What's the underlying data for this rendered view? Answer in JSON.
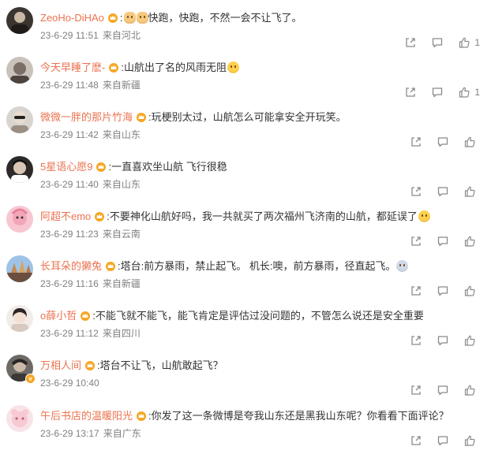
{
  "theme": {
    "username_color": "#eb7350",
    "meta_color": "#808080",
    "text_color": "#333333",
    "badge_color": "#f5a623"
  },
  "icons": {
    "share": "share-icon",
    "comment": "comment-icon",
    "like": "thumbs-up-icon",
    "member": "crown-icon"
  },
  "comments": [
    {
      "user": "ZeoHo-DiHAo",
      "text": ":",
      "text2": "快跑，快跑，不然一会不让飞了。",
      "emoji": "cat",
      "emoji_count": 2,
      "time": "23-6-29 11:51",
      "location": "来自河北",
      "likes": "1",
      "avatar": "a0"
    },
    {
      "user": "今天早睡了麽-",
      "text": ":山航出了名的风雨无阻",
      "text2": "",
      "emoji": "tear",
      "emoji_count": 1,
      "time": "23-6-29 11:48",
      "location": "来自新疆",
      "likes": "1",
      "avatar": "a1"
    },
    {
      "user": "微微一胖的那片竹海",
      "text": ":玩梗别太过，山航怎么可能拿安全开玩笑。",
      "text2": "",
      "emoji": "",
      "emoji_count": 0,
      "time": "23-6-29 11:42",
      "location": "来自山东",
      "likes": "",
      "avatar": "a2"
    },
    {
      "user": "5星语心愿9",
      "text": ":一直喜欢坐山航  飞行很稳",
      "text2": "",
      "emoji": "",
      "emoji_count": 0,
      "time": "23-6-29 11:40",
      "location": "来自山东",
      "likes": "",
      "avatar": "a3"
    },
    {
      "user": "阿超不emo",
      "text": ":不要神化山航好吗，我一共就买了两次福州飞济南的山航，都延误了",
      "text2": "",
      "emoji": "scream",
      "emoji_count": 1,
      "time": "23-6-29 11:23",
      "location": "来自云南",
      "likes": "",
      "avatar": "a4"
    },
    {
      "user": "长耳朵的獭兔",
      "text": ":塔台:前方暴雨，禁止起飞。 机长:噢，前方暴雨，径直起飞。",
      "text2": "",
      "emoji": "blue",
      "emoji_count": 1,
      "time": "23-6-29 11:16",
      "location": "来自新疆",
      "likes": "",
      "avatar": "a5"
    },
    {
      "user": "o薛小哲",
      "text": ":不能飞就不能飞，能飞肯定是评估过没问题的，不管怎么说还是安全重要",
      "text2": "",
      "emoji": "",
      "emoji_count": 0,
      "time": "23-6-29 11:12",
      "location": "来自四川",
      "likes": "",
      "avatar": "a6"
    },
    {
      "user": "万相人间",
      "text": ":塔台不让飞，山航敢起飞？",
      "text2": "",
      "emoji": "",
      "emoji_count": 0,
      "time": "23-6-29 10:40",
      "location": "",
      "likes": "",
      "avatar": "a7"
    },
    {
      "user": "午后书店的温暖阳光",
      "text": ":你发了这一条微博是夸我山东还是黑我山东呢？你看看下面评论？",
      "text2": "",
      "emoji": "",
      "emoji_count": 0,
      "time": "23-6-29 13:17",
      "location": "来自广东",
      "likes": "",
      "avatar": "a8"
    }
  ]
}
